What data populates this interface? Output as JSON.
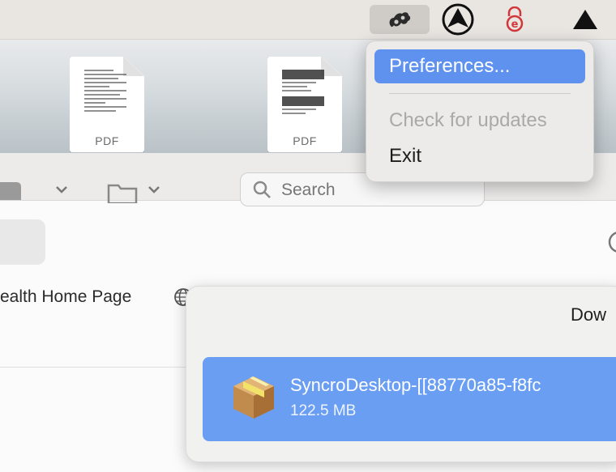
{
  "menubar": {
    "icons": [
      "syncro-icon",
      "navigation-icon",
      "e-reader-icon",
      "triangle-icon"
    ],
    "accent": "#cfcbc6"
  },
  "desktop": {
    "files": [
      {
        "label": "PDF"
      },
      {
        "label": "PDF"
      }
    ]
  },
  "browser": {
    "search": {
      "placeholder": "Search"
    },
    "bookmarks": {
      "item_label": "ealth Home Page"
    }
  },
  "downloads": {
    "title": "Dow",
    "item": {
      "name": "SyncroDesktop-[[88770a85-f8fc",
      "size": "122.5 MB"
    },
    "highlight": "#6a9ef3"
  },
  "syncro_menu": {
    "items": [
      {
        "label": "Preferences...",
        "state": "highlighted"
      },
      {
        "label": "Check for updates",
        "state": "disabled"
      },
      {
        "label": "Exit",
        "state": "normal"
      }
    ],
    "highlight": "#5e92ee"
  }
}
